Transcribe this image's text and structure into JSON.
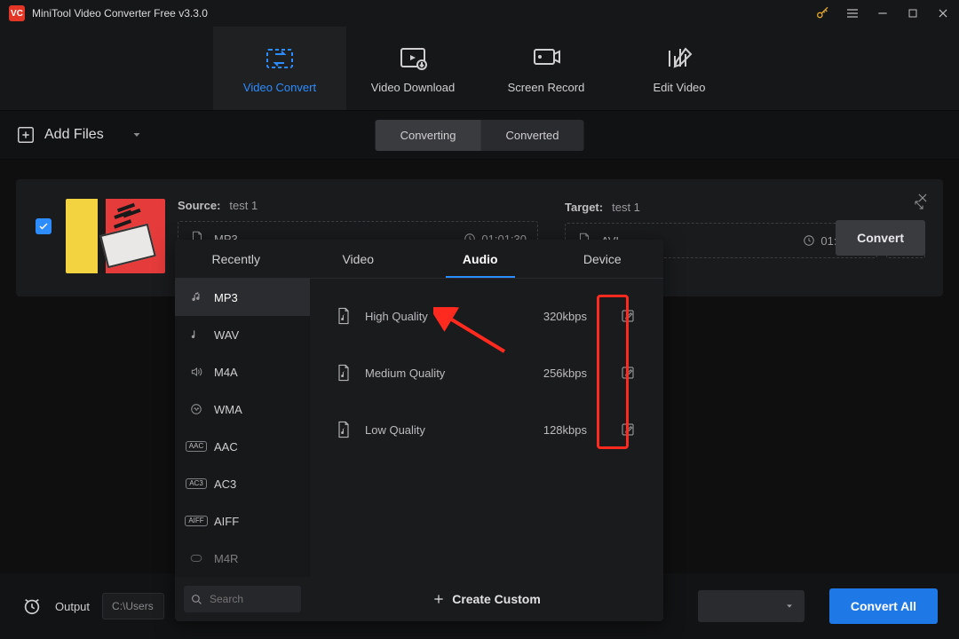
{
  "titlebar": {
    "title": "MiniTool Video Converter Free v3.3.0"
  },
  "nav": {
    "video_convert": "Video Convert",
    "video_download": "Video Download",
    "screen_record": "Screen Record",
    "edit_video": "Edit Video"
  },
  "toolbar": {
    "add_files": "Add Files",
    "converting": "Converting",
    "converted": "Converted"
  },
  "file": {
    "source_label": "Source:",
    "source_name": "test 1",
    "source_format": "MP3",
    "source_duration": "01:01:30",
    "target_label": "Target:",
    "target_name": "test 1",
    "target_format": "AVI",
    "target_duration": "01:01:30",
    "convert_button": "Convert"
  },
  "picker": {
    "tabs": {
      "recently": "Recently",
      "video": "Video",
      "audio": "Audio",
      "device": "Device"
    },
    "left": [
      "MP3",
      "WAV",
      "M4A",
      "WMA",
      "AAC",
      "AC3",
      "AIFF",
      "M4R"
    ],
    "right": [
      {
        "label": "High Quality",
        "rate": "320kbps"
      },
      {
        "label": "Medium Quality",
        "rate": "256kbps"
      },
      {
        "label": "Low Quality",
        "rate": "128kbps"
      }
    ],
    "search_placeholder": "Search",
    "create_custom": "Create Custom"
  },
  "bottom": {
    "output_label": "Output",
    "output_path": "C:\\Users",
    "convert_all": "Convert All"
  }
}
